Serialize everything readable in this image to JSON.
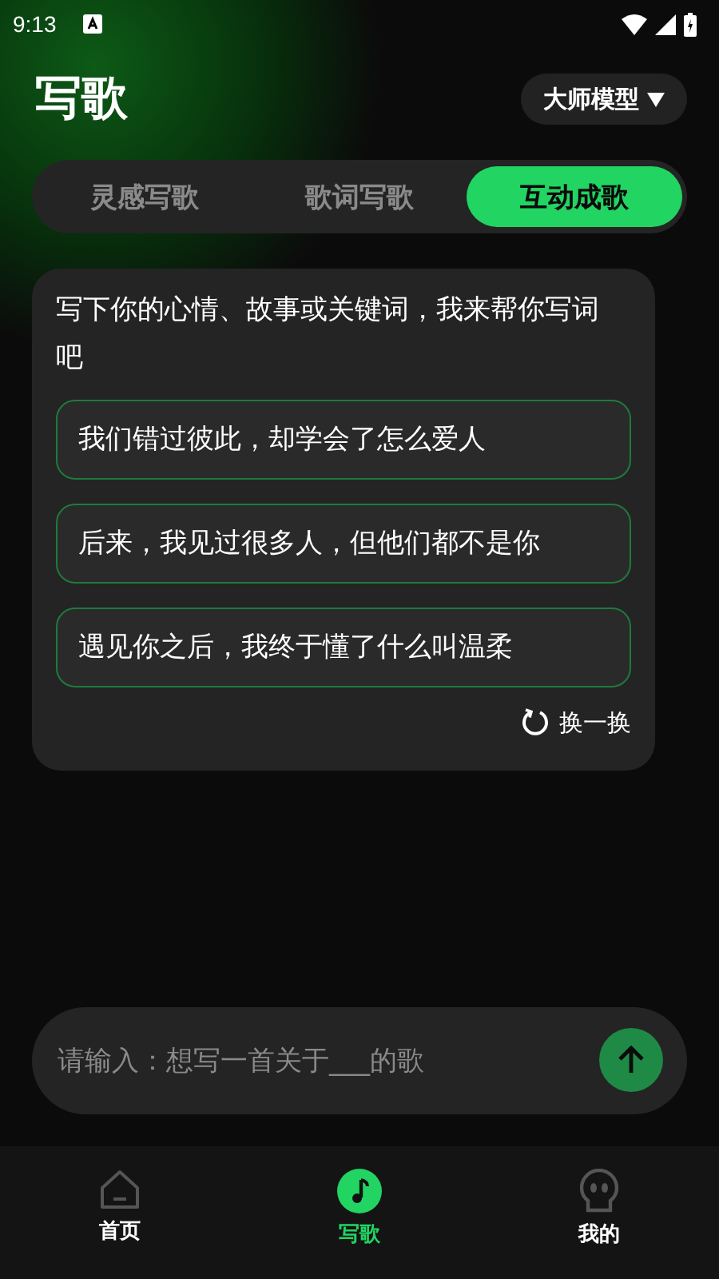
{
  "status_bar": {
    "time": "9:13"
  },
  "header": {
    "title": "写歌",
    "model_button": "大师模型"
  },
  "tabs": [
    {
      "label": "灵感写歌",
      "selected": false
    },
    {
      "label": "歌词写歌",
      "selected": false
    },
    {
      "label": "互动成歌",
      "selected": true
    }
  ],
  "card": {
    "prompt": "写下你的心情、故事或关键词，我来帮你写词吧",
    "suggestions": [
      "我们错过彼此，却学会了怎么爱人",
      "后来，我见过很多人，但他们都不是你",
      "遇见你之后，我终于懂了什么叫温柔"
    ],
    "refresh": "换一换"
  },
  "input": {
    "placeholder": "请输入：想写一首关于___的歌"
  },
  "nav": [
    {
      "label": "首页",
      "kind": "home",
      "selected": false
    },
    {
      "label": "写歌",
      "kind": "music",
      "selected": true
    },
    {
      "label": "我的",
      "kind": "profile",
      "selected": false
    }
  ]
}
